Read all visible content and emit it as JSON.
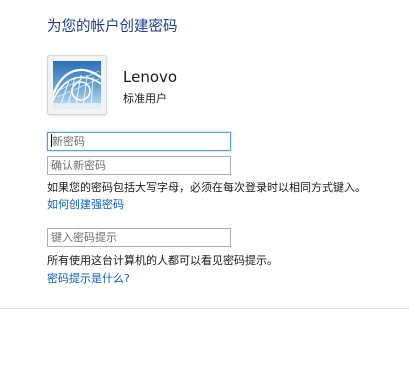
{
  "page": {
    "title": "为您的帐户创建密码"
  },
  "account": {
    "name": "Lenovo",
    "type": "标准用户",
    "avatar_icon": "roller-coaster-picture-icon"
  },
  "form": {
    "new_password": {
      "placeholder": "新密码",
      "value": ""
    },
    "confirm_password": {
      "placeholder": "确认新密码",
      "value": ""
    },
    "caps_note": "如果您的密码包括大写字母，必须在每次登录时以相同方式键入。",
    "strong_password_link": "如何创建强密码",
    "hint": {
      "placeholder": "键入密码提示",
      "value": ""
    },
    "hint_note": "所有使用这台计算机的人都可以看见密码提示。",
    "hint_help_link": "密码提示是什么?"
  },
  "colors": {
    "title": "#1e3c8f",
    "link": "#0d5fb9",
    "focus_border": "#5f9ed3"
  }
}
